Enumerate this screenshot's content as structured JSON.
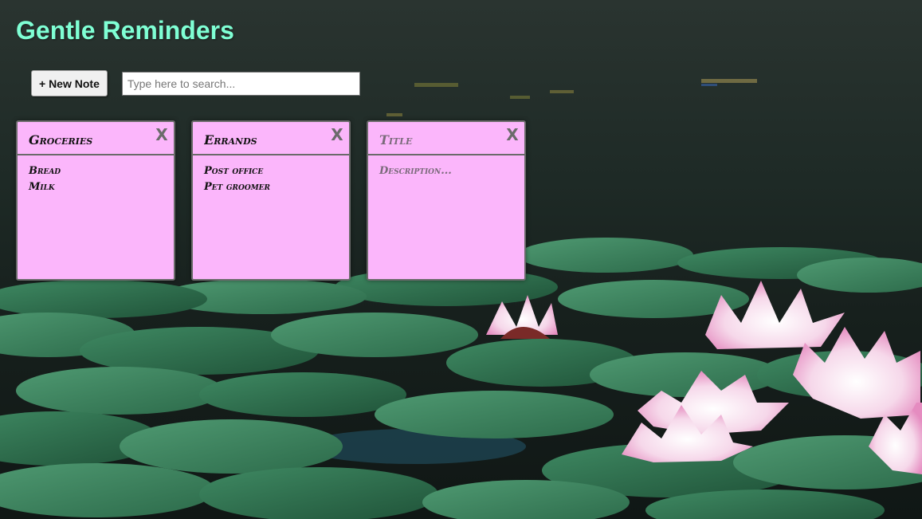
{
  "header": {
    "title": "Gentle Reminders"
  },
  "toolbar": {
    "new_note_label": "+ New Note",
    "search_placeholder": "Type here to search...",
    "search_value": ""
  },
  "notes": [
    {
      "title": "Groceries",
      "title_placeholder": "Title",
      "description": "Bread\nMilk",
      "description_placeholder": "Description...",
      "close_label": "X"
    },
    {
      "title": "Errands",
      "title_placeholder": "Title",
      "description": "Post office\nPet groomer",
      "description_placeholder": "Description...",
      "close_label": "X"
    },
    {
      "title": "",
      "title_placeholder": "Title",
      "description": "",
      "description_placeholder": "Description...",
      "close_label": "X"
    }
  ],
  "colors": {
    "title_text": "#7fffd4",
    "note_background": "#fbb6fb",
    "note_border": "#6a6a6a",
    "close_icon": "#6b6b6b"
  },
  "icons": {
    "close": "close-icon"
  }
}
